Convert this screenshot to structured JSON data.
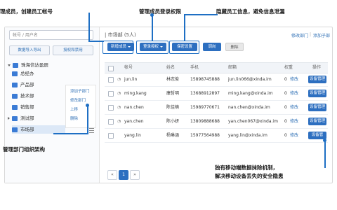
{
  "callouts": {
    "add_member": "理成员，创建员工帐号",
    "permissions": "管理成员登录权限",
    "hide_info": "隐藏员工信息，避免信息泄漏",
    "org_structure": "管理部门组织架构",
    "mobile_wipe_line1": "独有移动端数据抹除机制，",
    "mobile_wipe_line2": "解决移动设备丢失的安全隐患"
  },
  "sidebar": {
    "search_placeholder": "帐号 / 用户名",
    "import_export": "数据导入导出",
    "authorize_disable": "授权和禁用",
    "root": "珠海信达盈辰",
    "departments": [
      "总经办",
      "产品部",
      "技术部",
      "销售部",
      "测试部",
      "市场部"
    ],
    "context_menu": [
      "添加子部门",
      "修改部门",
      "上移",
      "删除"
    ]
  },
  "header": {
    "title": "市场部 (5人)",
    "edit_dept": "修改部门",
    "add_sub": "添加子部"
  },
  "toolbar": {
    "add_member": "新增成员",
    "login_auth": "登录授权",
    "privacy": "保密设置",
    "transfer": "调岗",
    "delete": "删除"
  },
  "table": {
    "columns": [
      "帐号",
      "姓名",
      "手机",
      "邮箱",
      "权重",
      "操作"
    ],
    "rows": [
      {
        "account": "jun.lin",
        "name": "林志俊",
        "phone": "15898745888",
        "email": "jun.lin066@xinda.im",
        "weight": "0",
        "edit": "修改",
        "manage": "设备管理"
      },
      {
        "account": "ming.kang",
        "name": "康哲明",
        "phone": "13688912897",
        "email": "ming.kang@xinda.im",
        "weight": "0",
        "edit": "修改",
        "manage": "设备管理"
      },
      {
        "account": "nan.chen",
        "name": "陈佳楠",
        "phone": "15989770671",
        "email": "nan.chen@xinda.im",
        "weight": "0",
        "edit": "修改",
        "manage": "设备管理"
      },
      {
        "account": "yan.chen",
        "name": "陈小妍",
        "phone": "13809888688",
        "email": "yan.chen067@xinda.im",
        "weight": "0",
        "edit": "修改",
        "manage": "设备管理"
      },
      {
        "account": "yang.lin",
        "name": "杨琳涵",
        "phone": "15977564988",
        "email": "yang.lin@xinda.im",
        "weight": "0",
        "edit": "修改",
        "manage": "设备管"
      }
    ]
  },
  "pagination": {
    "prev": "«",
    "current": "1",
    "next": "»"
  },
  "colors": {
    "accent": "#2d6fc0",
    "callout": "#1e6fc4"
  }
}
